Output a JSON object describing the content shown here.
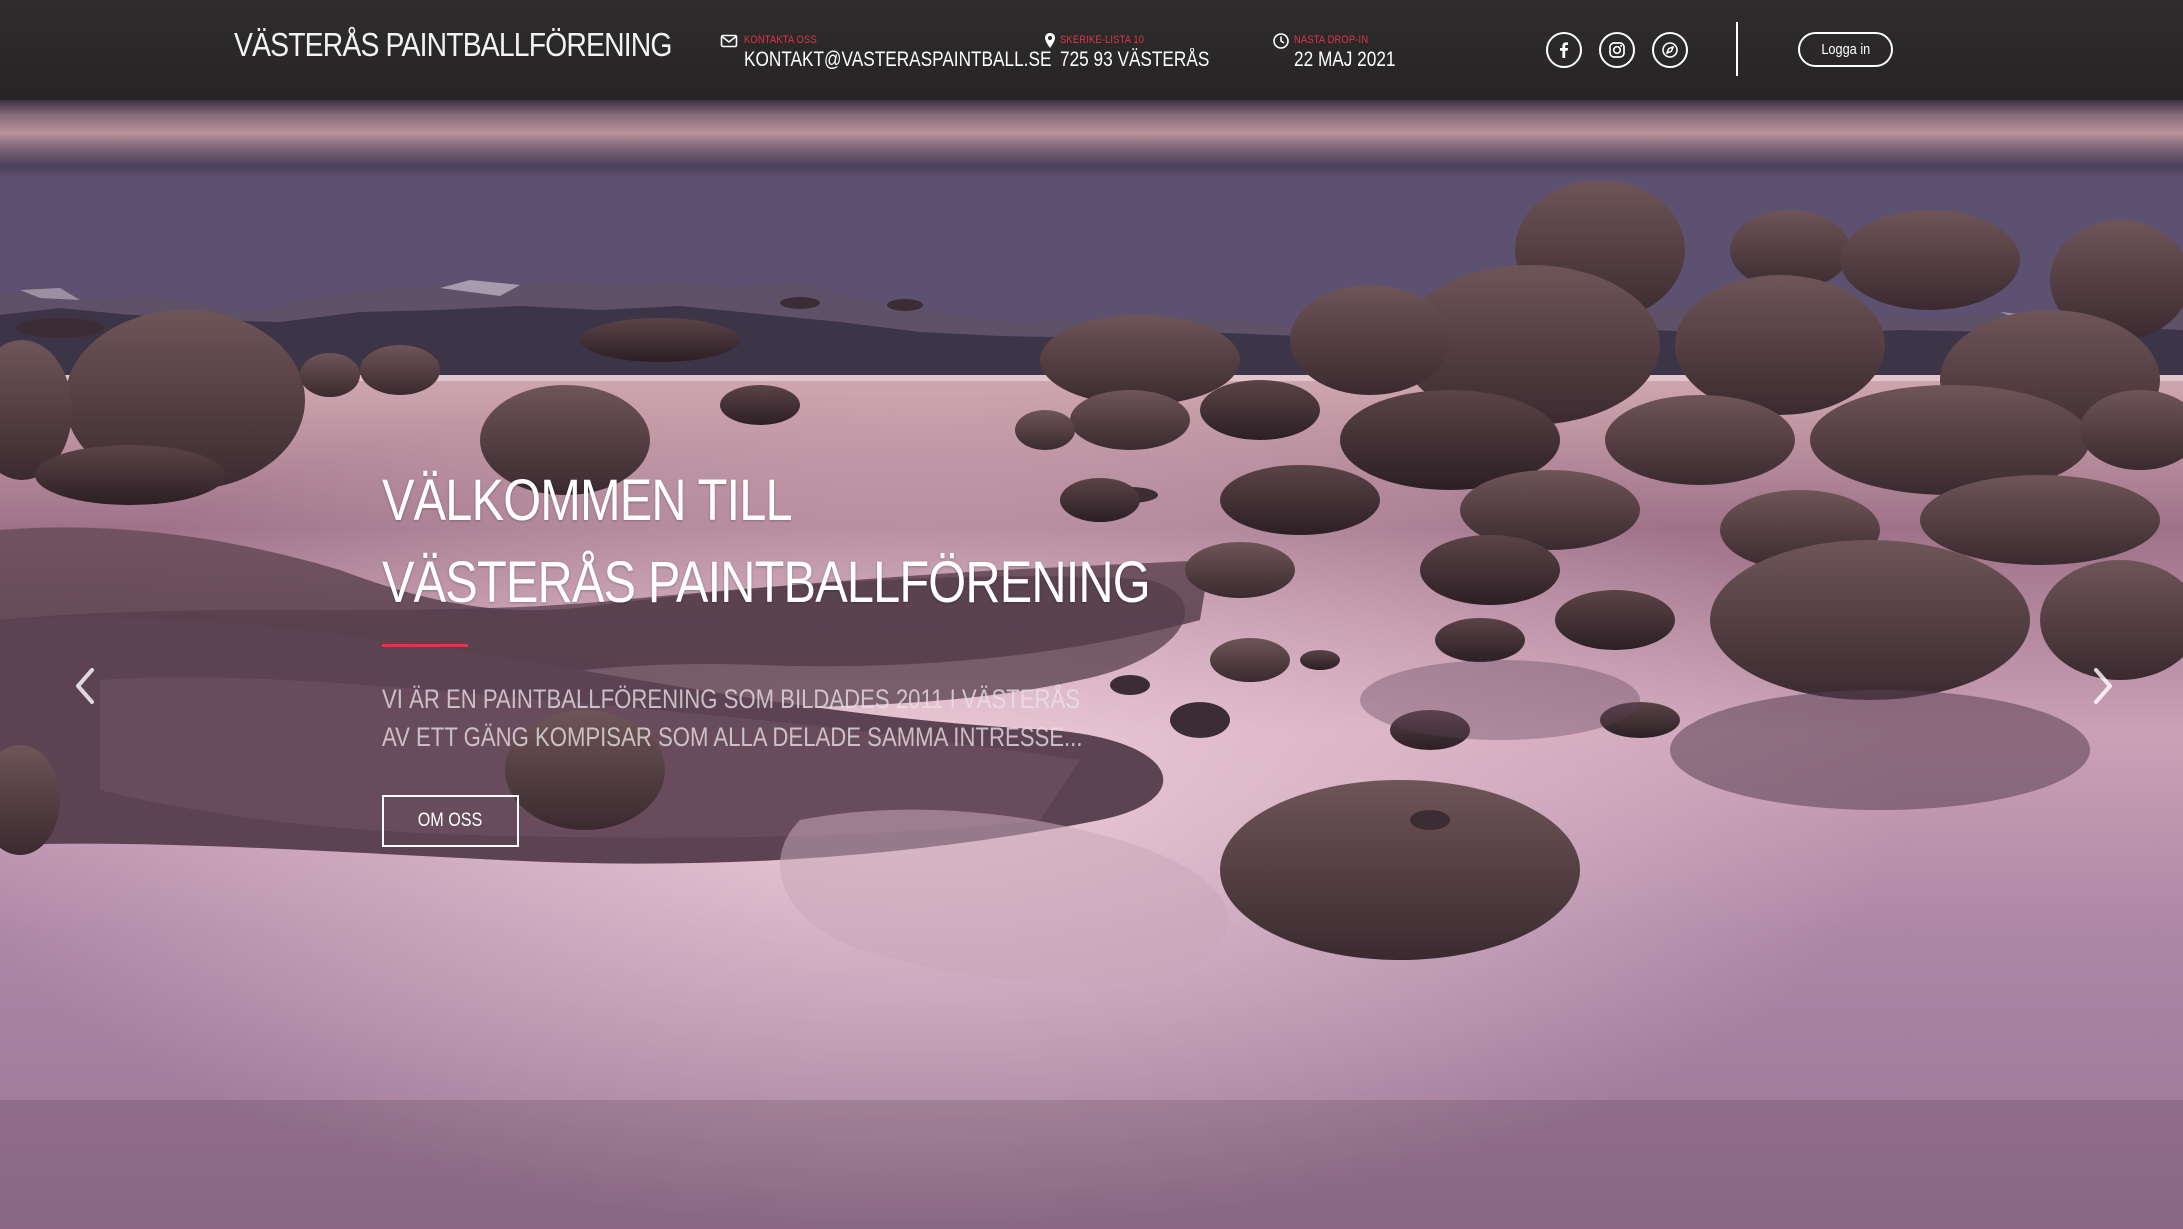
{
  "header": {
    "brand": "VÄSTERÅS PAINTBALLFÖRENING",
    "contact": {
      "label": "KONTAKTA OSS",
      "value": "KONTAKT@VASTERASPAINTBALL.SE",
      "icon": "envelope-icon"
    },
    "address": {
      "label": "SKERIKE-LISTA 10",
      "value": "725 93 VÄSTERÅS",
      "icon": "map-pin-icon"
    },
    "dropin": {
      "label": "NÄSTA DROP-IN",
      "value": "22 MAJ 2021",
      "icon": "clock-icon"
    },
    "social": [
      {
        "name": "facebook",
        "icon": "facebook-icon"
      },
      {
        "name": "instagram",
        "icon": "instagram-icon"
      },
      {
        "name": "web",
        "icon": "compass-icon"
      }
    ],
    "login_label": "Logga in"
  },
  "hero": {
    "title_line1": "VÄLKOMMEN TILL",
    "title_line2": "VÄSTERÅS PAINTBALLFÖRENING",
    "text": "VI ÄR EN PAINTBALLFÖRENING SOM BILDADES 2011 I VÄSTERÅS AV ETT GÄNG KOMPISAR SOM ALLA DELADE SAMMA INTRESSE...",
    "button_label": "OM OSS",
    "prev_icon": "chevron-left-icon",
    "next_icon": "chevron-right-icon"
  },
  "colors": {
    "accent": "#e2344a",
    "header_bg": "#2b2929",
    "text": "#ffffff"
  }
}
